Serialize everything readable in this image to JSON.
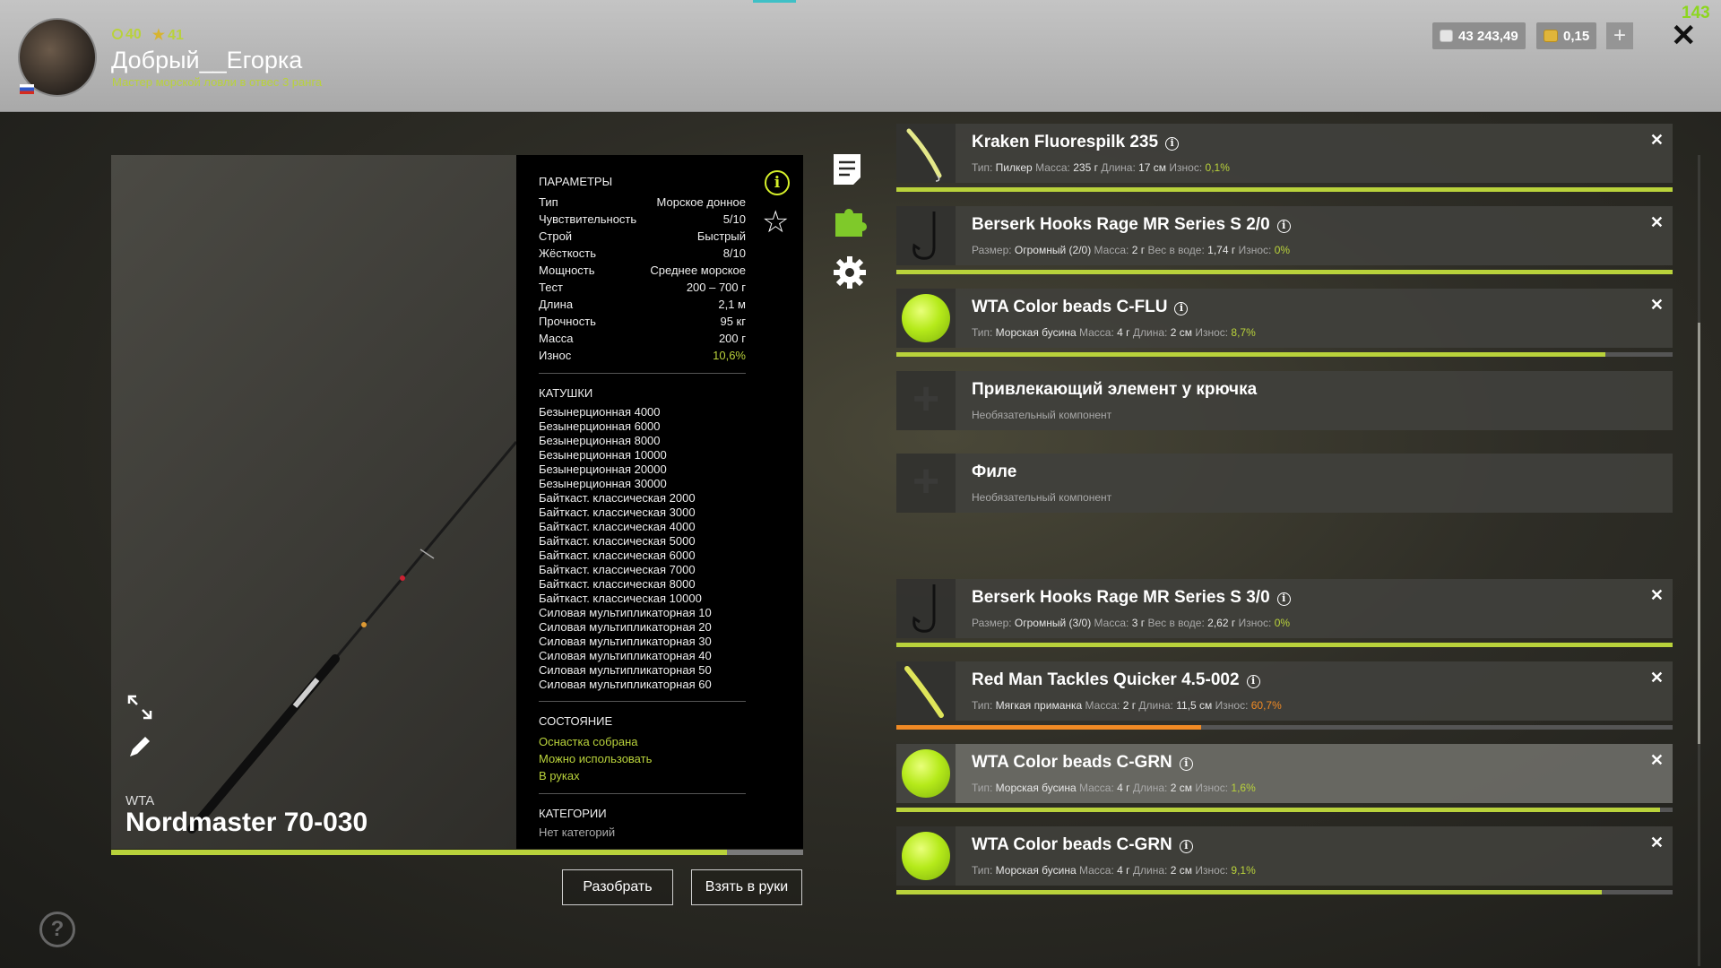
{
  "header": {
    "level": "40",
    "rating": "41",
    "username": "Добрый__Егорка",
    "rank": "Мастер морской ловли в отвес 3 ранга",
    "silver": "43 243,49",
    "gold": "0,15",
    "counter": "143"
  },
  "rod": {
    "brand": "WTA",
    "name": "Nordmaster 70-030",
    "wear_progress": 0.89
  },
  "params": {
    "title": "ПАРАМЕТРЫ",
    "rows": [
      {
        "label": "Тип",
        "value": "Морское донное"
      },
      {
        "label": "Чувствительность",
        "value": "5/10"
      },
      {
        "label": "Строй",
        "value": "Быстрый"
      },
      {
        "label": "Жёсткость",
        "value": "8/10"
      },
      {
        "label": "Мощность",
        "value": "Среднее морское"
      },
      {
        "label": "Тест",
        "value": "200 – 700 г"
      },
      {
        "label": "Длина",
        "value": "2,1 м"
      },
      {
        "label": "Прочность",
        "value": "95 кг"
      },
      {
        "label": "Масса",
        "value": "200 г"
      },
      {
        "label": "Износ",
        "value": "10,6%"
      }
    ]
  },
  "reels": {
    "title": "КАТУШКИ",
    "items": [
      "Безынерционная 4000",
      "Безынерционная 6000",
      "Безынерционная 8000",
      "Безынерционная 10000",
      "Безынерционная 20000",
      "Безынерционная 30000",
      "Байткаст. классическая 2000",
      "Байткаст. классическая 3000",
      "Байткаст. классическая 4000",
      "Байткаст. классическая 5000",
      "Байткаст. классическая 6000",
      "Байткаст. классическая 7000",
      "Байткаст. классическая 8000",
      "Байткаст. классическая 10000",
      "Силовая мультипликаторная 10",
      "Силовая мультипликаторная 20",
      "Силовая мультипликаторная 30",
      "Силовая мультипликаторная 40",
      "Силовая мультипликаторная 50",
      "Силовая мультипликаторная 60"
    ]
  },
  "state": {
    "title": "СОСТОЯНИЕ",
    "items": [
      "Оснастка собрана",
      "Можно использовать",
      "В руках"
    ]
  },
  "categories": {
    "title": "КАТЕГОРИИ",
    "value": "Нет категорий"
  },
  "buttons": {
    "disassemble": "Разобрать",
    "take": "Взять в руки"
  },
  "slots": [
    {
      "title": "Kraken Fluorespilk 235",
      "icon": "pilker-icon",
      "sub": [
        [
          "Тип: ",
          "Пилкер"
        ],
        [
          "Масса: ",
          "235 г"
        ],
        [
          "Длина: ",
          "17 см"
        ]
      ],
      "wear_label": "Износ: ",
      "wear": "0,1%",
      "wear_color": "#b9d23b",
      "bar": 1.0,
      "bar_color": "#b9d23b",
      "removable": true
    },
    {
      "title": "Berserk Hooks Rage MR Series S 2/0",
      "icon": "hook-icon",
      "sub": [
        [
          "Размер: ",
          "Огромный (2/0)"
        ],
        [
          "Масса: ",
          "2 г"
        ],
        [
          "Вес в воде: ",
          "1,74 г"
        ]
      ],
      "wear_label": "Износ: ",
      "wear": "0%",
      "wear_color": "#b9d23b",
      "bar": 1.0,
      "bar_color": "#b9d23b",
      "removable": true
    },
    {
      "title": "WTA Color beads C-FLU",
      "icon": "bead-icon",
      "sub": [
        [
          "Тип: ",
          "Морская бусина"
        ],
        [
          "Масса: ",
          "4 г"
        ],
        [
          "Длина: ",
          "2 см"
        ]
      ],
      "wear_label": "Износ: ",
      "wear": "8,7%",
      "wear_color": "#b9d23b",
      "bar": 0.913,
      "bar_color": "#b9d23b",
      "removable": true
    },
    {
      "title": "Привлекающий элемент у крючка",
      "icon": "plus-icon",
      "optional": "Необязательный компонент"
    },
    {
      "title": "Филе",
      "icon": "plus-icon",
      "optional": "Необязательный компонент"
    },
    {
      "title": "Berserk Hooks Rage MR Series S 3/0",
      "icon": "hook-icon",
      "sub": [
        [
          "Размер: ",
          "Огромный (3/0)"
        ],
        [
          "Масса: ",
          "3 г"
        ],
        [
          "Вес в воде: ",
          "2,62 г"
        ]
      ],
      "wear_label": "Износ: ",
      "wear": "0%",
      "wear_color": "#b9d23b",
      "bar": 1.0,
      "bar_color": "#b9d23b",
      "removable": true
    },
    {
      "title": "Red Man Tackles Quicker 4.5-002",
      "icon": "soft-bait-icon",
      "sub": [
        [
          "Тип: ",
          "Мягкая приманка"
        ],
        [
          "Масса: ",
          "2 г"
        ],
        [
          "Длина: ",
          "11,5 см"
        ]
      ],
      "wear_label": "Износ: ",
      "wear": "60,7%",
      "wear_color": "#f08a24",
      "bar": 0.393,
      "bar_color": "#f08a24",
      "removable": true
    },
    {
      "title": "WTA Color beads C-GRN",
      "icon": "bead-icon",
      "sub": [
        [
          "Тип: ",
          "Морская бусина"
        ],
        [
          "Масса: ",
          "4 г"
        ],
        [
          "Длина: ",
          "2 см"
        ]
      ],
      "wear_label": "Износ: ",
      "wear": "1,6%",
      "wear_color": "#b9d23b",
      "bar": 0.984,
      "bar_color": "#b9d23b",
      "removable": true,
      "highlight": true
    },
    {
      "title": "WTA Color beads C-GRN",
      "icon": "bead-icon",
      "sub": [
        [
          "Тип: ",
          "Морская бусина"
        ],
        [
          "Масса: ",
          "4 г"
        ],
        [
          "Длина: ",
          "2 см"
        ]
      ],
      "wear_label": "Износ: ",
      "wear": "9,1%",
      "wear_color": "#b9d23b",
      "bar": 0.909,
      "bar_color": "#b9d23b",
      "removable": true
    }
  ]
}
